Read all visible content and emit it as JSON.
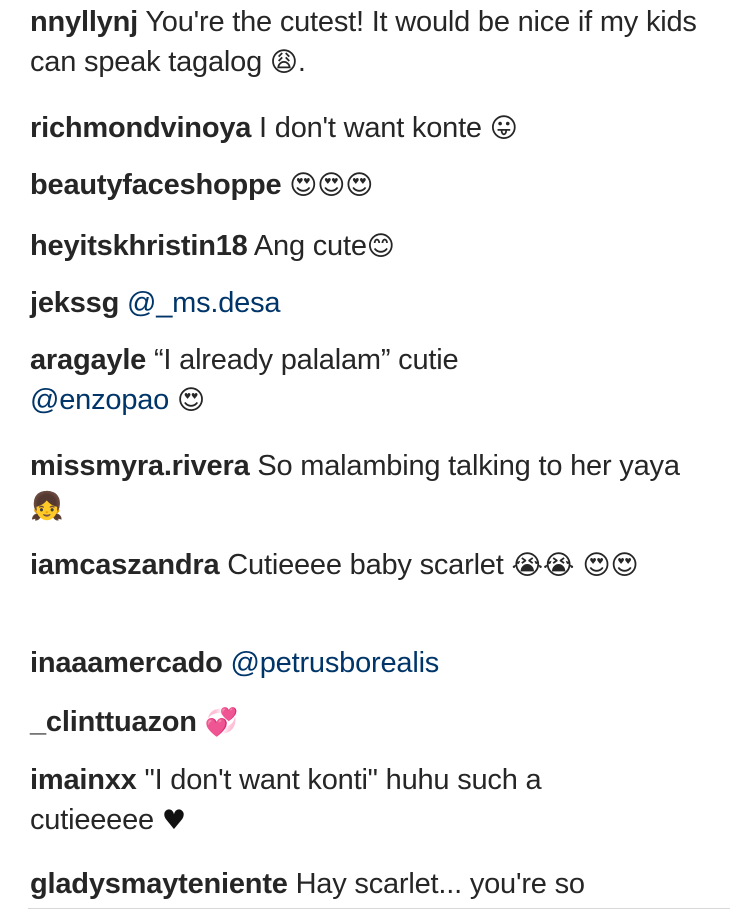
{
  "comments": [
    {
      "username": "nnyllynj",
      "text": "You're the cutest! It would be nice if my kids can speak tagalog",
      "emoji": "😩",
      "after": "."
    },
    {
      "username": "richmondvinoya",
      "text": "I don't want konte",
      "emoji": "😛"
    },
    {
      "username": "beautyfaceshoppe",
      "text": "",
      "emoji": "😍😍😍"
    },
    {
      "username": "heyitskhristin18",
      "text": "Ang cute",
      "emoji": "😊"
    },
    {
      "username": "jekssg",
      "mention": "@_ms.desa"
    },
    {
      "username": "aragayle",
      "text": "“I already palalam” cutie",
      "mention": "@enzopao",
      "emoji": "😍"
    },
    {
      "username": "missmyra.rivera",
      "text": "So malambing talking to her yaya",
      "emoji": "👧"
    },
    {
      "username": "iamcaszandra",
      "text": "Cutieeee baby scarlet",
      "emoji": "😭😭 😍😍"
    },
    {
      "username": "inaaamercado",
      "mention": "@petrusborealis"
    },
    {
      "username": "_clinttuazon",
      "emoji": "💞"
    },
    {
      "username": "imainxx",
      "text": "\"I don't want konti\" huhu such a cutieeeee",
      "emoji": "♥"
    },
    {
      "username": "gladysmayteniente",
      "text": "Hay scarlet... you're so"
    }
  ]
}
